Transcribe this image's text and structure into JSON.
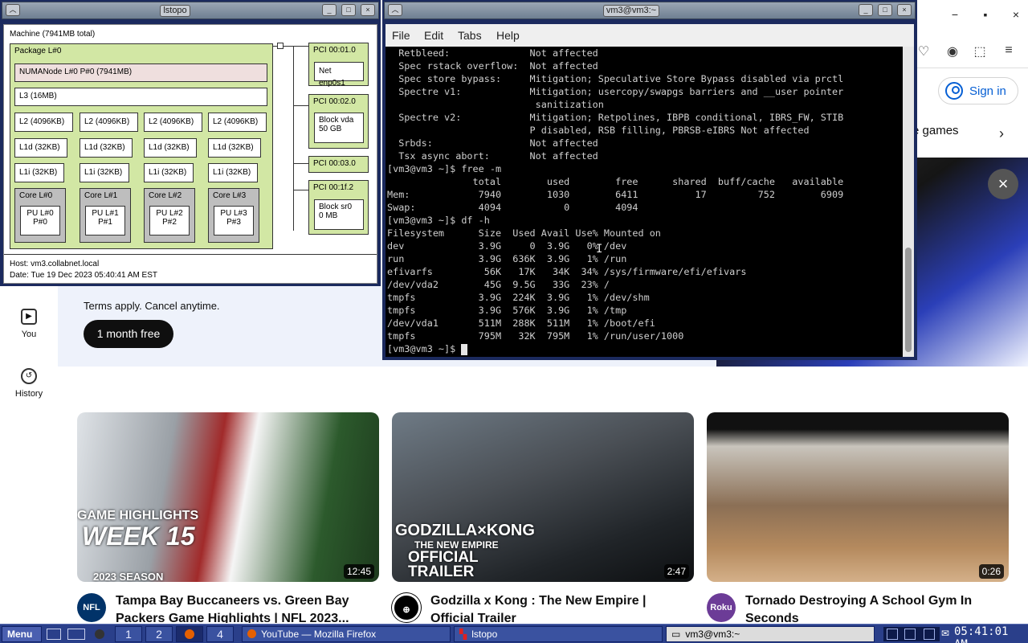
{
  "firefox": {
    "controls": [
      "−",
      "▪",
      "×"
    ],
    "signin": "Sign in",
    "chip": "e games",
    "banner": {
      "terms": "Terms apply. Cancel anytime.",
      "cta": "1 month free"
    },
    "sidebar": [
      {
        "label": "You"
      },
      {
        "label": "History"
      }
    ],
    "videos": [
      {
        "overlay1": "GAME HIGHLIGHTS",
        "overlay2": "WEEK 15",
        "overlay3": "2023 SEASON",
        "duration": "12:45",
        "channel": "NFL",
        "title": "Tampa Bay Buccaneers vs. Green Bay Packers Game Highlights | NFL 2023..."
      },
      {
        "overlay1": "GODZILLA×KONG",
        "overlay2": "THE NEW EMPIRE",
        "overlay3": "OFFICIAL TRAILER",
        "duration": "2:47",
        "channel": "",
        "title": "Godzilla x Kong : The New Empire | Official Trailer"
      },
      {
        "overlay1": "",
        "overlay2": "",
        "overlay3": "",
        "duration": "0:26",
        "channel": "Roku",
        "title": "Tornado Destroying A School Gym In Seconds"
      }
    ]
  },
  "lstopo": {
    "title": "lstopo",
    "machine": "Machine (7941MB total)",
    "package": "Package L#0",
    "numa": "NUMANode L#0 P#0 (7941MB)",
    "l3": "L3 (16MB)",
    "cores": [
      {
        "l2": "L2 (4096KB)",
        "l1d": "L1d (32KB)",
        "l1i": "L1i (32KB)",
        "core": "Core L#0",
        "pu1": "PU L#0",
        "pu2": "P#0"
      },
      {
        "l2": "L2 (4096KB)",
        "l1d": "L1d (32KB)",
        "l1i": "L1i (32KB)",
        "core": "Core L#1",
        "pu1": "PU L#1",
        "pu2": "P#1"
      },
      {
        "l2": "L2 (4096KB)",
        "l1d": "L1d (32KB)",
        "l1i": "L1i (32KB)",
        "core": "Core L#2",
        "pu1": "PU L#2",
        "pu2": "P#2"
      },
      {
        "l2": "L2 (4096KB)",
        "l1d": "L1d (32KB)",
        "l1i": "L1i (32KB)",
        "core": "Core L#3",
        "pu1": "PU L#3",
        "pu2": "P#3"
      }
    ],
    "pci": [
      {
        "addr": "PCI 00:01.0",
        "dev1": "Net enp0s1",
        "dev2": ""
      },
      {
        "addr": "PCI 00:02.0",
        "dev1": "Block vda",
        "dev2": "50 GB"
      },
      {
        "addr": "PCI 00:03.0",
        "dev1": "",
        "dev2": ""
      },
      {
        "addr": "PCI 00:1f.2",
        "dev1": "Block sr0",
        "dev2": "0 MB"
      }
    ],
    "host": "Host: vm3.collabnet.local",
    "date": "Date: Tue 19 Dec 2023 05:40:41 AM EST"
  },
  "terminal": {
    "title": "vm3@vm3:~",
    "menu": [
      "File",
      "Edit",
      "Tabs",
      "Help"
    ],
    "lines": [
      "  Retbleed:              Not affected",
      "  Spec rstack overflow:  Not affected",
      "  Spec store bypass:     Mitigation; Speculative Store Bypass disabled via prctl",
      "  Spectre v1:            Mitigation; usercopy/swapgs barriers and __user pointer",
      "                          sanitization",
      "  Spectre v2:            Mitigation; Retpolines, IBPB conditional, IBRS_FW, STIB",
      "                         P disabled, RSB filling, PBRSB-eIBRS Not affected",
      "  Srbds:                 Not affected",
      "  Tsx async abort:       Not affected",
      "[vm3@vm3 ~]$ free -m",
      "               total        used        free      shared  buff/cache   available",
      "Mem:            7940        1030        6411          17         752        6909",
      "Swap:           4094           0        4094",
      "[vm3@vm3 ~]$ df -h",
      "Filesystem      Size  Used Avail Use% Mounted on",
      "dev             3.9G     0  3.9G   0% /dev",
      "run             3.9G  636K  3.9G   1% /run",
      "efivarfs         56K   17K   34K  34% /sys/firmware/efi/efivars",
      "/dev/vda2        45G  9.5G   33G  23% /",
      "tmpfs           3.9G  224K  3.9G   1% /dev/shm",
      "tmpfs           3.9G  576K  3.9G   1% /tmp",
      "/dev/vda1       511M  288K  511M   1% /boot/efi",
      "tmpfs           795M   32K  795M   1% /run/user/1000"
    ],
    "prompt": "[vm3@vm3 ~]$ "
  },
  "taskbar": {
    "menu": "Menu",
    "desktops": [
      "1",
      "2",
      "",
      "4"
    ],
    "tasks": [
      "YouTube — Mozilla Firefox",
      "lstopo",
      "vm3@vm3:~"
    ],
    "clock": "05:41:01 AM"
  }
}
